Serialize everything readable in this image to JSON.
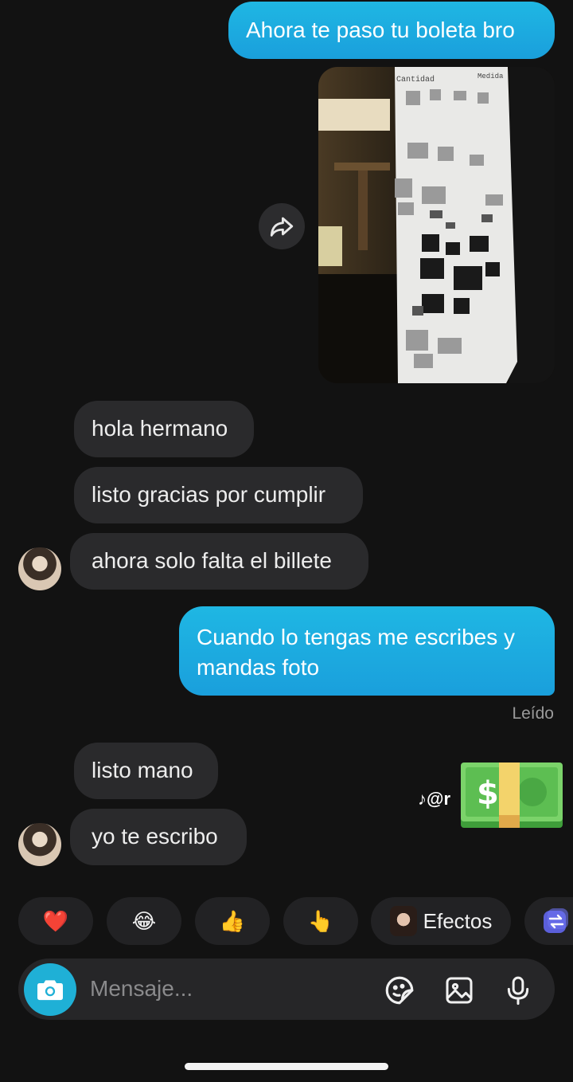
{
  "messages": {
    "sent_1": "Ahora te paso tu boleta bro",
    "received_1": "hola hermano",
    "received_2": "listo gracias por cumplir",
    "received_3": "ahora solo falta el billete",
    "sent_2": "Cuando lo tengas me escribes y mandas foto",
    "read_status": "Leído",
    "received_4": "listo mano",
    "received_5": "yo te escribo"
  },
  "receipt_photo": {
    "header_left": "Cantidad",
    "header_right": "Medida"
  },
  "watermark": {
    "icon": "tiktok-icon",
    "text": "@r"
  },
  "sticker": {
    "icon": "money-with-wings-emoji"
  },
  "reactions": {
    "heart": "❤️",
    "laugh": "😂",
    "thumbs_up": "👍",
    "pointing": "👆",
    "effects_label": "Efectos"
  },
  "composer": {
    "placeholder": "Mensaje..."
  },
  "colors": {
    "background": "#121212",
    "sent_bubble": "#1fb0de",
    "received_bubble": "#2a2a2c",
    "camera_button": "#1fb0d6"
  }
}
